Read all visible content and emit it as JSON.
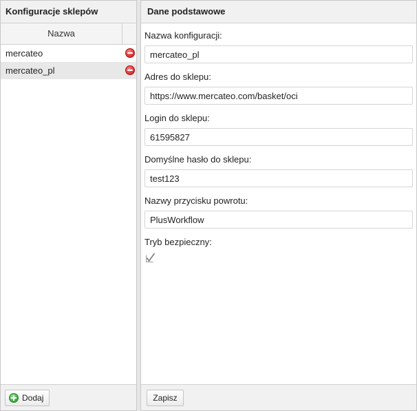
{
  "left_panel": {
    "title": "Konfiguracje sklepów",
    "column_header": "Nazwa",
    "rows": [
      {
        "name": "mercateo"
      },
      {
        "name": "mercateo_pl"
      }
    ],
    "add_label": "Dodaj"
  },
  "right_panel": {
    "title": "Dane podstawowe",
    "fields": {
      "config_name": {
        "label": "Nazwa konfiguracji:",
        "value": "mercateo_pl"
      },
      "shop_address": {
        "label": "Adres do sklepu:",
        "value": "https://www.mercateo.com/basket/oci"
      },
      "shop_login": {
        "label": "Login do sklepu:",
        "value": "61595827"
      },
      "default_password": {
        "label": "Domyślne hasło do sklepu:",
        "value": "test123"
      },
      "return_button_name": {
        "label": "Nazwy przycisku powrotu:",
        "value": "PlusWorkflow"
      }
    },
    "safe_mode": {
      "label": "Tryb bezpieczny:",
      "checked": true
    },
    "save_label": "Zapisz"
  },
  "colors": {
    "header_bg": "#f1f1f1",
    "selected_row_bg": "#e8e8e8",
    "delete_icon": "#e23b3b",
    "add_icon": "#3fae3f"
  }
}
